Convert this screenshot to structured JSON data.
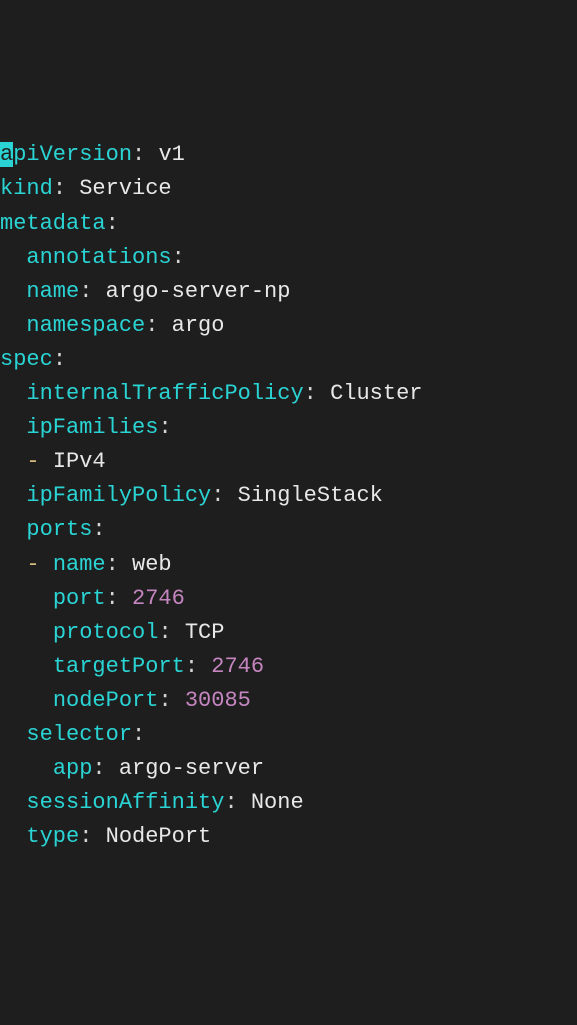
{
  "lines": {
    "l1_key": "apiVersion",
    "l1_cursor": "a",
    "l1_rest": "piVersion",
    "l1_val": "v1",
    "l2_key": "kind",
    "l2_val": "Service",
    "l3_key": "metadata",
    "l4_key": "annotations",
    "l5_key": "name",
    "l5_val": "argo-server-np",
    "l6_key": "namespace",
    "l6_val": "argo",
    "l7_key": "spec",
    "l8_key": "internalTrafficPolicy",
    "l8_val": "Cluster",
    "l9_key": "ipFamilies",
    "l10_dash": "-",
    "l10_val": "IPv4",
    "l11_key": "ipFamilyPolicy",
    "l11_val": "SingleStack",
    "l12_key": "ports",
    "l13_dash": "-",
    "l13_key": "name",
    "l13_val": "web",
    "l14_key": "port",
    "l14_val": "2746",
    "l15_key": "protocol",
    "l15_val": "TCP",
    "l16_key": "targetPort",
    "l16_val": "2746",
    "l17_key": "nodePort",
    "l17_val": "30085",
    "l18_key": "selector",
    "l19_key": "app",
    "l19_val": "argo-server",
    "l20_key": "sessionAffinity",
    "l20_val": "None",
    "l21_key": "type",
    "l21_val": "NodePort"
  }
}
